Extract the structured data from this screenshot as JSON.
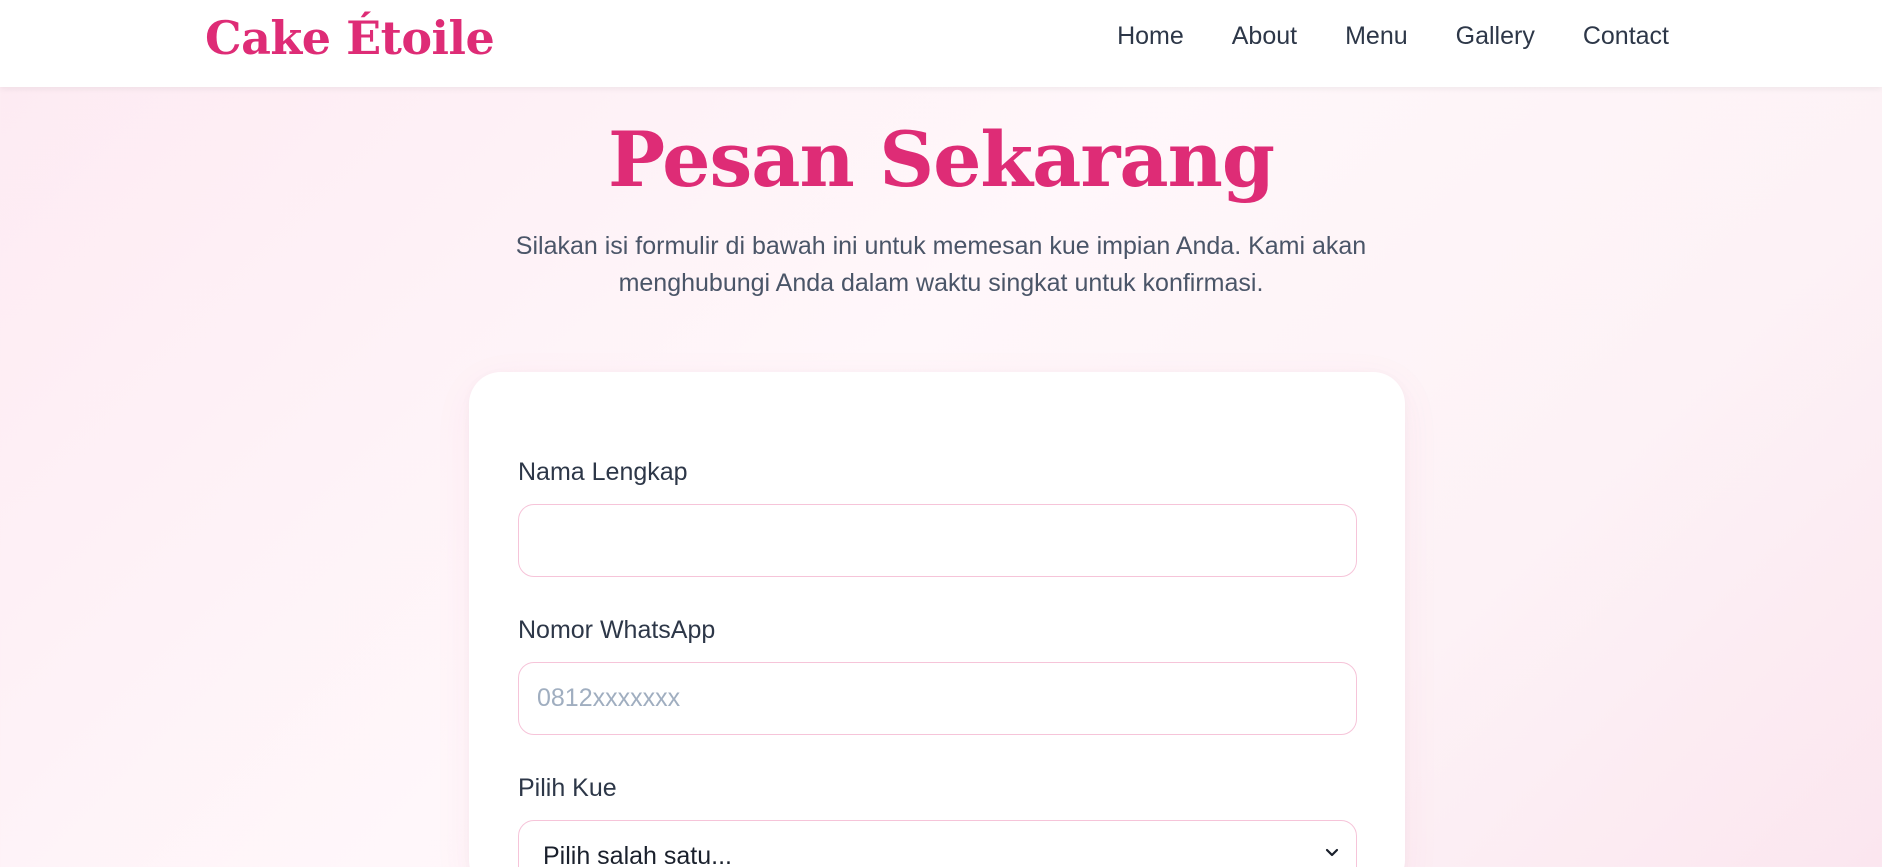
{
  "brand": {
    "name": "Cake Étoile"
  },
  "nav": {
    "items": [
      {
        "label": "Home"
      },
      {
        "label": "About"
      },
      {
        "label": "Menu"
      },
      {
        "label": "Gallery"
      },
      {
        "label": "Contact"
      }
    ]
  },
  "hero": {
    "title": "Pesan Sekarang",
    "subtitle": "Silakan isi formulir di bawah ini untuk memesan kue impian Anda. Kami akan menghubungi Anda dalam waktu singkat untuk konfirmasi."
  },
  "form": {
    "name": {
      "label": "Nama Lengkap",
      "value": "",
      "placeholder": ""
    },
    "whatsapp": {
      "label": "Nomor WhatsApp",
      "value": "",
      "placeholder": "0812xxxxxxx"
    },
    "cake": {
      "label": "Pilih Kue",
      "selected": "Pilih salah satu..."
    }
  },
  "colors": {
    "brand": "#de2c76",
    "text": "#2d3748",
    "input_border": "#f6c4d9",
    "placeholder": "#a0aec0"
  },
  "icons": {
    "select_chevron": "chevron-down-icon"
  }
}
